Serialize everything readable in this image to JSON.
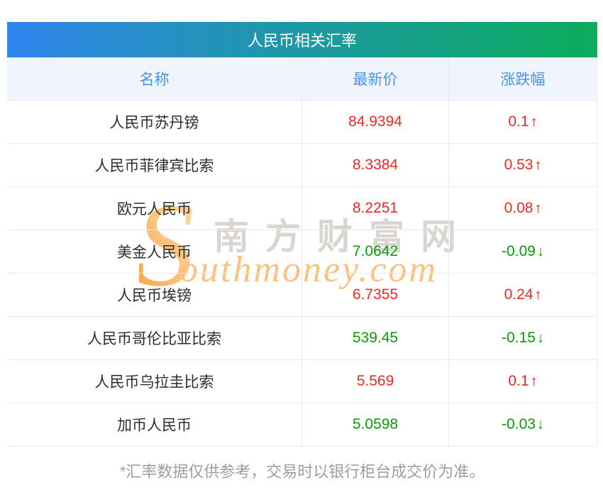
{
  "title": "人民币相关汇率",
  "columns": {
    "name": "名称",
    "price": "最新价",
    "change": "涨跌幅"
  },
  "rows": [
    {
      "name": "人民币苏丹镑",
      "price": "84.9394",
      "change": "0.1",
      "arrow": "↑",
      "direction": "up"
    },
    {
      "name": "人民币菲律宾比索",
      "price": "8.3384",
      "change": "0.53",
      "arrow": "↑",
      "direction": "up"
    },
    {
      "name": "欧元人民币",
      "price": "8.2251",
      "change": "0.08",
      "arrow": "↑",
      "direction": "up"
    },
    {
      "name": "美金人民币",
      "price": "7.0642",
      "change": "-0.09",
      "arrow": "↓",
      "direction": "down"
    },
    {
      "name": "人民币埃镑",
      "price": "6.7355",
      "change": "0.24",
      "arrow": "↑",
      "direction": "up"
    },
    {
      "name": "人民币哥伦比亚比索",
      "price": "539.45",
      "change": "-0.15",
      "arrow": "↓",
      "direction": "down"
    },
    {
      "name": "人民币乌拉圭比索",
      "price": "5.569",
      "change": "0.1",
      "arrow": "↑",
      "direction": "up"
    },
    {
      "name": "加币人民币",
      "price": "5.0598",
      "change": "-0.03",
      "arrow": "↓",
      "direction": "down"
    }
  ],
  "footnote": "*汇率数据仅供参考，交易时以银行柜台成交价为准。",
  "watermark": {
    "initial": "S",
    "rest": "outhmoney.com",
    "cn": "南方财富网"
  },
  "colors": {
    "up": "#f52626",
    "down": "#0a990a",
    "header_text": "#4b93e6",
    "header_bg": "#f0f5fd",
    "gradient_start": "#2f85ec",
    "gradient_end": "#0bac5b",
    "border": "#e8eaf2",
    "footnote_text": "#9e9e9e",
    "watermark_cn": "#d8d4cf",
    "watermark_en": "#f8c07c"
  }
}
